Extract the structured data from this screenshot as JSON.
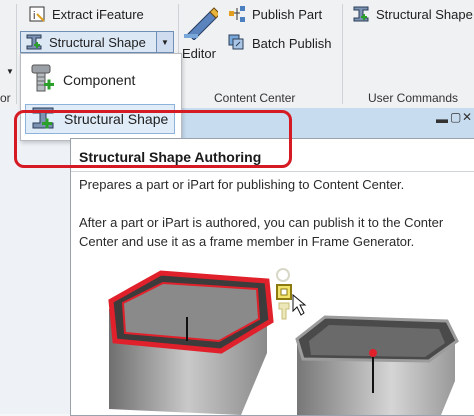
{
  "ribbon": {
    "extract_ifeature": "Extract iFeature",
    "structural_shape_split": "Structural Shape",
    "editor": "Editor",
    "publish_part": "Publish Part",
    "batch_publish": "Batch Publish",
    "structural_shape_right": "Structural Shape",
    "group_content_center": "Content Center",
    "group_user_commands": "User Commands",
    "group_left_fragment": "or"
  },
  "dropdown": {
    "items": [
      {
        "label": "Component",
        "icon": "bolt-component-icon"
      },
      {
        "label": "Structural Shape",
        "icon": "structural-shape-icon"
      }
    ]
  },
  "tooltip": {
    "title": "Structural Shape Authoring",
    "line1": "Prepares a part or iPart for publishing to Content Center.",
    "line2": "After a part or iPart is authored, you can publish it to the Conter",
    "line3": "Center and use it as a frame member in Frame Generator."
  },
  "colors": {
    "callout": "#d61a23",
    "accent_green": "#2aa02a",
    "profile_highlight": "#e0202a"
  }
}
